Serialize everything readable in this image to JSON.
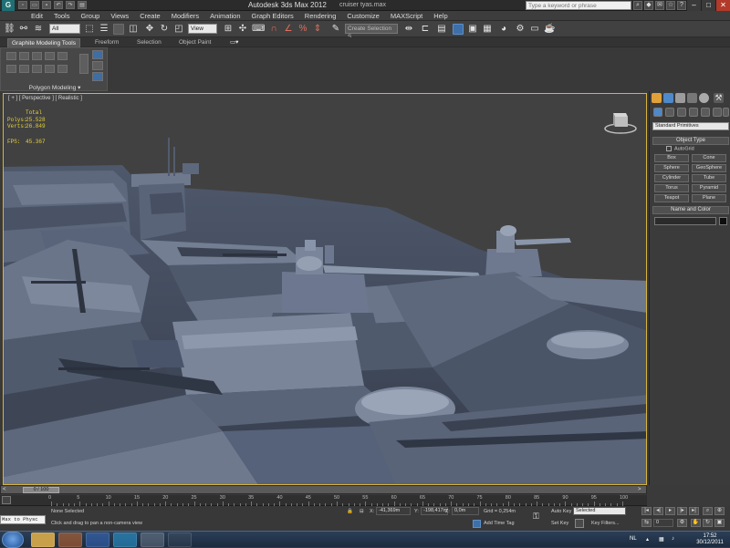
{
  "app": {
    "title": "Autodesk 3ds Max  2012",
    "file": "cruiser tyas.max",
    "logo_text": "G",
    "search_placeholder": "Type a keyword or phrase"
  },
  "menu": [
    "Edit",
    "Tools",
    "Group",
    "Views",
    "Create",
    "Modifiers",
    "Animation",
    "Graph Editors",
    "Rendering",
    "Customize",
    "MAXScript",
    "Help"
  ],
  "toolbar": {
    "filter_value": "All",
    "coord_value": "View",
    "selection_set_placeholder": "Create Selection S"
  },
  "ribbon": {
    "tabs": [
      "Graphite Modeling Tools",
      "Freeform",
      "Selection",
      "Object Paint"
    ],
    "panel_label": "Polygon Modeling",
    "panel_arrow": "▾"
  },
  "viewport": {
    "label": "[ + ] [ Perspective ] [ Realistic ]",
    "stats": {
      "total_label": "Total",
      "polys_label": "Polys:",
      "polys_value": "25.528",
      "verts_label": "Verts:",
      "verts_value": "26.849",
      "fps_label": "FPS:",
      "fps_value": "45.367"
    },
    "colors": {
      "background": "#414141",
      "hull": "#5f6b80",
      "hull_dark": "#434d5f",
      "hull_light": "#8792a6",
      "frame": "#d6b33b"
    }
  },
  "command_panel": {
    "dropdown_value": "Standard Primitives",
    "object_type_header": "Object Type",
    "autogrid_label": "AutoGrid",
    "primitives": [
      "Box",
      "Cone",
      "Sphere",
      "GeoSphere",
      "Cylinder",
      "Tube",
      "Torus",
      "Pyramid",
      "Teapot",
      "Plane"
    ],
    "name_color_header": "Name and Color"
  },
  "timeline": {
    "slider_text": "0 / 100",
    "ticks": [
      0,
      5,
      10,
      15,
      20,
      25,
      30,
      35,
      40,
      45,
      50,
      55,
      60,
      65,
      70,
      75,
      80,
      85,
      90,
      95,
      100
    ]
  },
  "status": {
    "maxscript_text": "Max to Physc",
    "selection_text": "None Selected",
    "prompt_text": "Click and drag to pan a non-camera view",
    "x_label": "X:",
    "x_value": "-41,369m",
    "y_label": "Y:",
    "y_value": "-198,417m",
    "z_label": "Z:",
    "z_value": "0,0m",
    "grid_text": "Grid = 0,254m",
    "add_time_tag": "Add Time Tag",
    "auto_key": "Auto Key",
    "set_key": "Set Key",
    "key_mode_value": "Selected",
    "key_filters": "Key Filters...",
    "frame_value": "0"
  },
  "taskbar": {
    "language": "NL",
    "time": "17:52",
    "date": "30/12/2011"
  }
}
